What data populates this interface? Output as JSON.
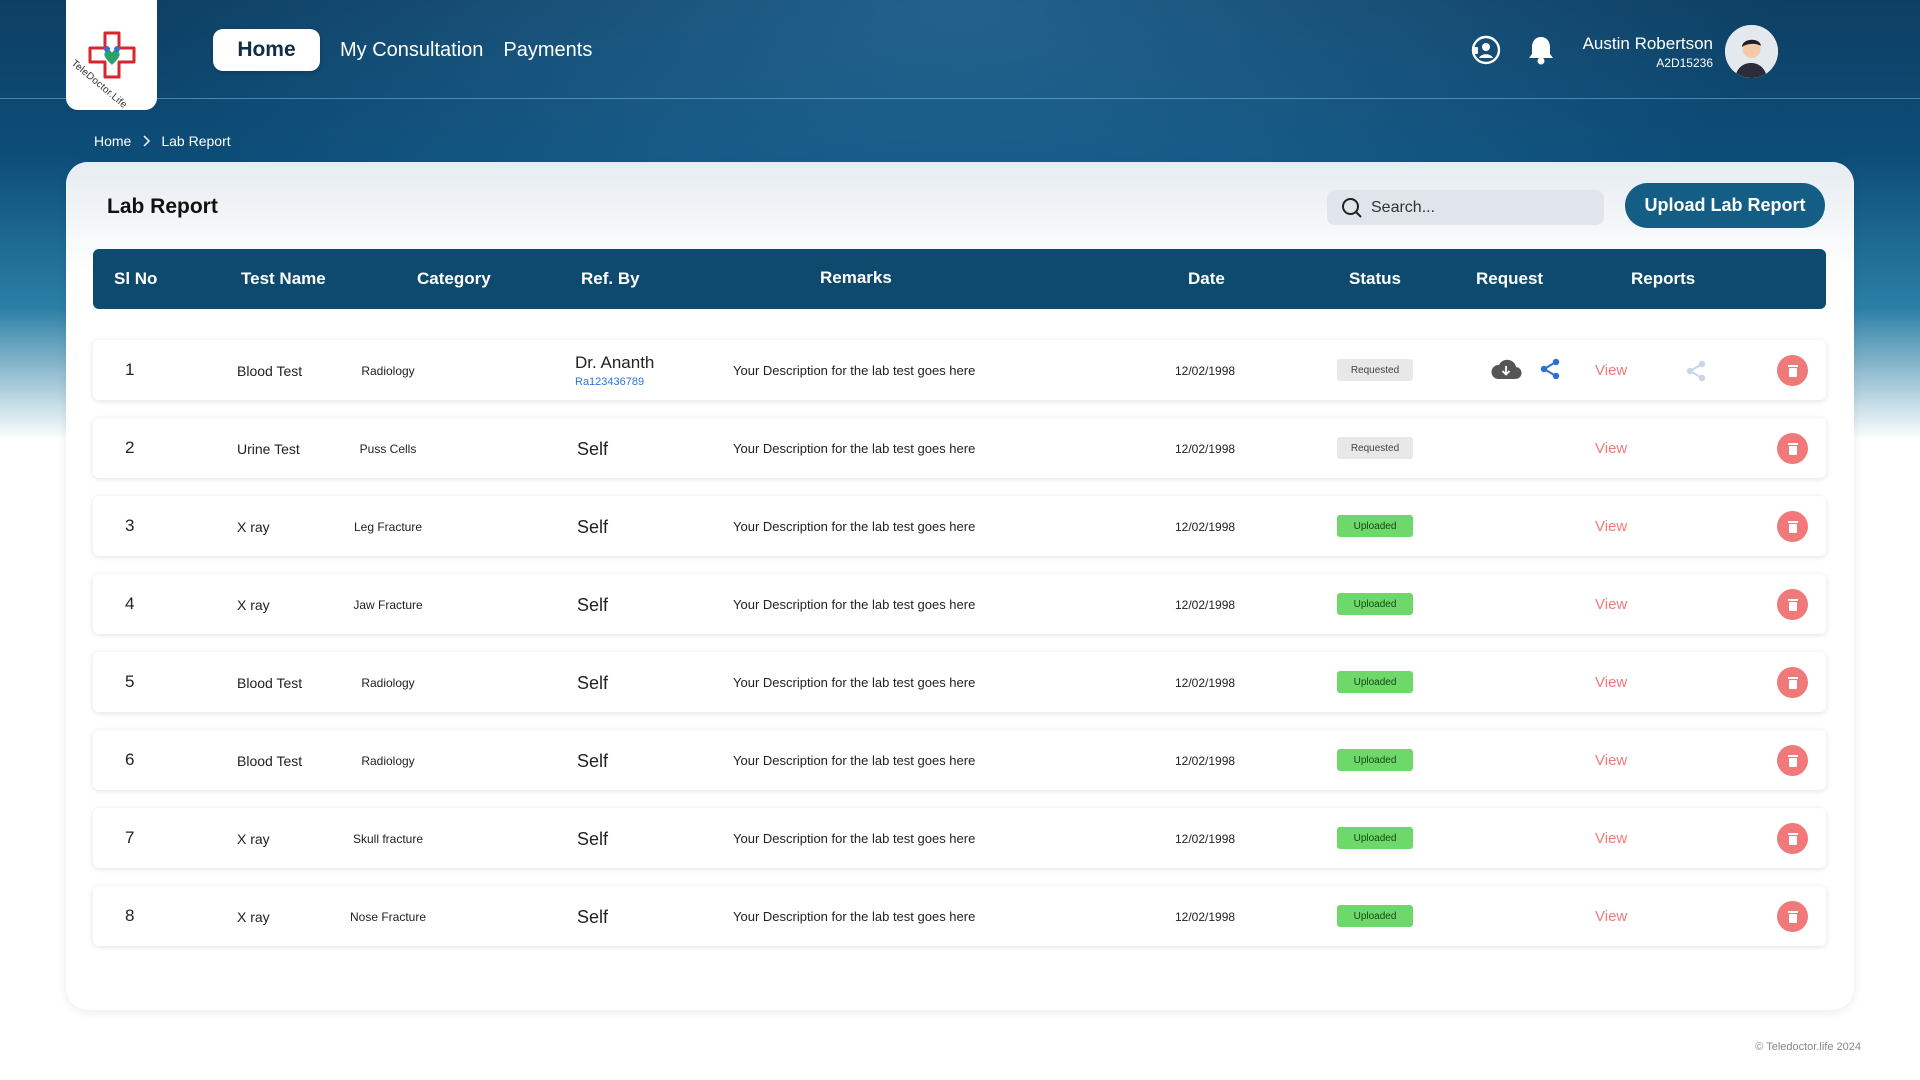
{
  "app": {
    "logo_text": "TeleDoctor.Life",
    "nav": {
      "home": "Home",
      "consultation": "My Consultation",
      "payments": "Payments"
    },
    "user": {
      "name": "Austin Robertson",
      "id": "A2D15236"
    }
  },
  "breadcrumb": {
    "home": "Home",
    "current": "Lab Report"
  },
  "page": {
    "title": "Lab Report",
    "search_placeholder": "Search...",
    "upload_label": "Upload Lab Report"
  },
  "table": {
    "headers": {
      "sl": "Sl No",
      "test": "Test Name",
      "category": "Category",
      "ref": "Ref. By",
      "remarks": "Remarks",
      "date": "Date",
      "status": "Status",
      "request": "Request",
      "reports": "Reports"
    },
    "rows": [
      {
        "sl": "1",
        "test": "Blood Test",
        "category": "Radiology",
        "ref": "Dr. Ananth",
        "ref_id": "Ra123436789",
        "remarks": "Your Description for the lab test goes here",
        "date": "12/02/1998",
        "status": "Requested",
        "view": "View"
      },
      {
        "sl": "2",
        "test": "Urine Test",
        "category": "Puss Cells",
        "ref": "Self",
        "remarks": "Your Description for the lab test goes here",
        "date": "12/02/1998",
        "status": "Requested",
        "view": "View"
      },
      {
        "sl": "3",
        "test": "X ray",
        "category": "Leg Fracture",
        "ref": "Self",
        "remarks": "Your Description for the lab test goes here",
        "date": "12/02/1998",
        "status": "Uploaded",
        "view": "View"
      },
      {
        "sl": "4",
        "test": "X ray",
        "category": "Jaw Fracture",
        "ref": "Self",
        "remarks": "Your Description for the lab test goes here",
        "date": "12/02/1998",
        "status": "Uploaded",
        "view": "View"
      },
      {
        "sl": "5",
        "test": "Blood Test",
        "category": "Radiology",
        "ref": "Self",
        "remarks": "Your Description for the lab test goes here",
        "date": "12/02/1998",
        "status": "Uploaded",
        "view": "View"
      },
      {
        "sl": "6",
        "test": "Blood Test",
        "category": "Radiology",
        "ref": "Self",
        "remarks": "Your Description for the lab test goes here",
        "date": "12/02/1998",
        "status": "Uploaded",
        "view": "View"
      },
      {
        "sl": "7",
        "test": "X ray",
        "category": "Skull fracture",
        "ref": "Self",
        "remarks": "Your Description for the lab test goes here",
        "date": "12/02/1998",
        "status": "Uploaded",
        "view": "View"
      },
      {
        "sl": "8",
        "test": "X ray",
        "category": "Nose Fracture",
        "ref": "Self",
        "remarks": "Your Description for the lab test goes here",
        "date": "12/02/1998",
        "status": "Uploaded",
        "view": "View"
      }
    ]
  },
  "footer": "© Teledoctor.life 2024",
  "icons": [
    "support-icon",
    "bell-icon",
    "search-icon",
    "cloud-download-icon",
    "share-icon",
    "trash-icon",
    "chevron-right-icon"
  ],
  "colors": {
    "header_dark": "#0e3f63",
    "table_header": "#0e4a6e",
    "upload_button": "#145e86",
    "view_link": "#f07a7a",
    "delete_button": "#f07a7a",
    "uploaded_badge": "#6fd86a",
    "requested_badge": "#e8e8e8"
  }
}
